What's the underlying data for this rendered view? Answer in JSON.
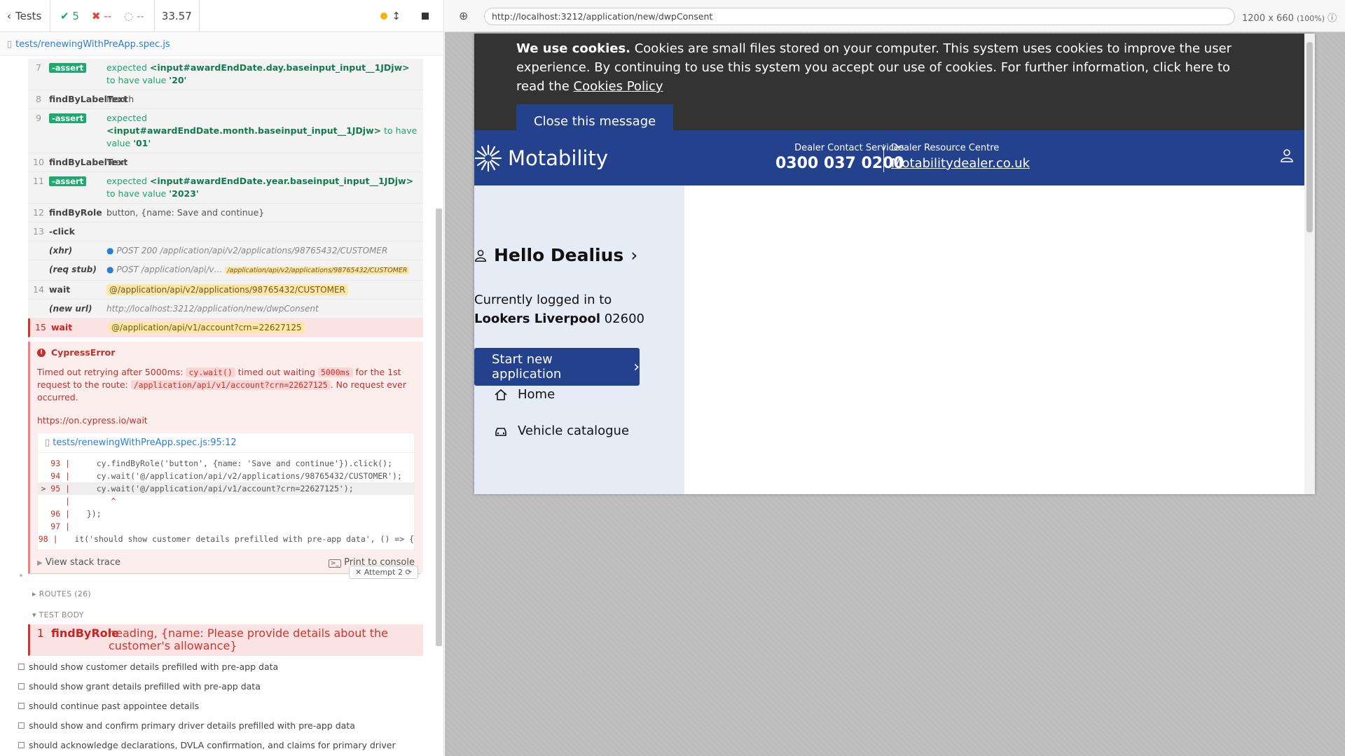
{
  "runner": {
    "back_label": "Tests",
    "passed": "5",
    "failed": "--",
    "pending": "--",
    "duration": "33.57"
  },
  "spec_file": "tests/renewingWithPreApp.spec.js",
  "commands": [
    {
      "num": "7",
      "name": "-assert",
      "pre": "expected",
      "selector": "<input#awardEndDate.day.baseinput_input__1JDjw>",
      "mid": "to have value",
      "value": "'20'"
    },
    {
      "num": "8",
      "name": "findByLabelText",
      "msg": "Month"
    },
    {
      "num": "9",
      "name": "-assert",
      "pre": "expected",
      "selector": "<input#awardEndDate.month.baseinput_input__1JDjw>",
      "mid": "to have value",
      "value": "'01'"
    },
    {
      "num": "10",
      "name": "findByLabelText",
      "msg": "Year"
    },
    {
      "num": "11",
      "name": "-assert",
      "pre": "expected",
      "selector": "<input#awardEndDate.year.baseinput_input__1JDjw>",
      "mid": "to have value",
      "value": "'2023'"
    },
    {
      "num": "12",
      "name": "findByRole",
      "msg": "button, {name: Save and continue}"
    },
    {
      "num": "13",
      "name": "-click",
      "msg": ""
    },
    {
      "num": "",
      "name": "(xhr)",
      "msg": "POST 200 /application/api/v2/applications/98765432/CUSTOMER"
    },
    {
      "num": "",
      "name": "(req stub)",
      "msg": "POST /application/api/v…",
      "badge": "/application/api/v2/applications/98765432/CUSTOMER"
    },
    {
      "num": "14",
      "name": "wait",
      "badge": "@/application/api/v2/applications/98765432/CUSTOMER"
    },
    {
      "num": "",
      "name": "(new url)",
      "msg": "http://localhost:3212/application/new/dwpConsent"
    },
    {
      "num": "15",
      "name": "wait",
      "badge": "@/application/api/v1/account?crn=22627125"
    }
  ],
  "error": {
    "title": "CypressError",
    "msg_1": "Timed out retrying after 5000ms:",
    "code_1": "cy.wait()",
    "msg_2": "timed out waiting",
    "code_2": "5000ms",
    "msg_3": "for the 1st request to the route:",
    "code_3": "/application/api/v1/account?crn=22627125",
    "msg_4": ". No request ever occurred.",
    "docs_link": "https://on.cypress.io/wait",
    "code_file": "tests/renewingWithPreApp.spec.js:95:12",
    "code_lines": [
      {
        "ln": "93 |",
        "text": "    cy.findByRole('button', {name: 'Save and continue'}).click();"
      },
      {
        "ln": "94 |",
        "text": "    cy.wait('@/application/api/v2/applications/98765432/CUSTOMER');"
      },
      {
        "ln": "> 95 |",
        "text": "    cy.wait('@/application/api/v1/account?crn=22627125');"
      },
      {
        "ln": "|",
        "text": "       ^"
      },
      {
        "ln": "96 |",
        "text": "  });"
      },
      {
        "ln": "97 |",
        "text": ""
      },
      {
        "ln": "98 |",
        "text": "  it('should show customer details prefilled with pre-app data', () => {"
      }
    ],
    "stack_trace_label": "View stack trace",
    "print_label": "Print to console"
  },
  "attempt_label": "Attempt 2",
  "routes_label": "ROUTES (26)",
  "test_body_label": "TEST BODY",
  "body_cmd": {
    "num": "1",
    "name": "findByRole",
    "msg": "heading, {name: Please provide details about the customer's allowance}"
  },
  "tests": [
    "should show customer details prefilled with pre-app data",
    "should show grant details prefilled with pre-app data",
    "should continue past appointee details",
    "should show and confirm primary driver details prefilled with pre-app data",
    "should acknowledge declarations, DVLA confirmation, and claims for primary driver"
  ],
  "preview": {
    "url": "http://localhost:3212/application/new/dwpConsent",
    "dims": "1200 x 660",
    "zoom": "(100%)"
  },
  "site": {
    "cookie_bold": "We use cookies.",
    "cookie_text": " Cookies are small files stored on your computer. This system uses cookies to improve the user experience. By continuing to use this system you accept our use of cookies. For further information, click here to read the ",
    "cookie_link": "Cookies Policy",
    "close_label": "Close this message",
    "logo": "Motability",
    "contact_label": "Dealer Contact Services",
    "contact_phone": "0300 037 0200",
    "resource_label": "Dealer Resource Centre",
    "resource_link": "Motabilitydealer.co.uk",
    "hello": "Hello Dealius",
    "logged_pre": "Currently logged in to ",
    "logged_bold": "Lookers Liverpool",
    "logged_code": " 02600",
    "start_label": "Start new application",
    "nav_home": "Home",
    "nav_vehicle": "Vehicle catalogue"
  },
  "colors": {
    "brand": "#23418d",
    "pass": "#1da56b",
    "fail": "#e0453a"
  }
}
